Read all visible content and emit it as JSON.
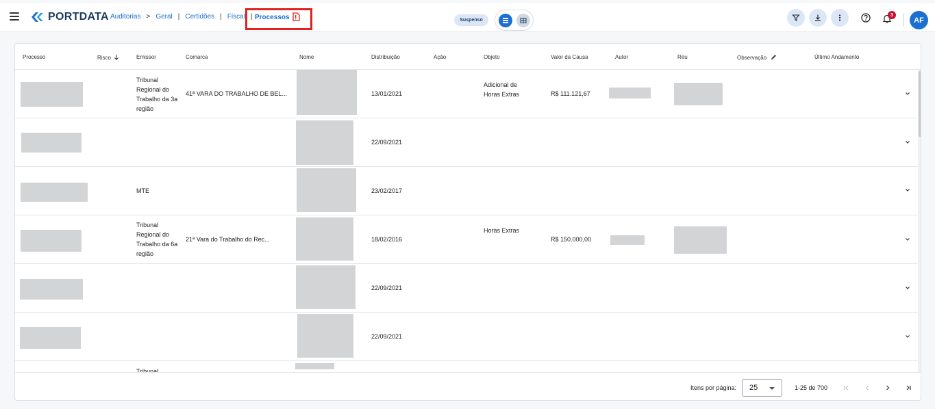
{
  "header": {
    "logo_text": "PORTDATA",
    "breadcrumb": [
      "Auditorias",
      "Geral",
      "Certidões",
      "Fiscal"
    ],
    "breadcrumb_arrow": ">",
    "breadcrumb_sep": "|",
    "current_page": "Processos",
    "status": "Suspenso",
    "notification_count": "3",
    "avatar_initials": "AF"
  },
  "table": {
    "columns": {
      "processo": "Processo",
      "risco": "Risco",
      "emissor": "Emissor",
      "comarca": "Comarca",
      "nome": "Nome",
      "distribuicao": "Distribuição",
      "acao": "Ação",
      "objeto": "Objeto",
      "valor": "Valor da Causa",
      "autor": "Autor",
      "reu": "Réu",
      "observacao": "Observação",
      "andamento": "Último Andamento"
    },
    "rows": [
      {
        "emissor": "Tribunal Regional do Trabalho da 3a região",
        "comarca": "41ª VARA DO TRABALHO DE BEL...",
        "distribuicao": "13/01/2021",
        "objeto": "Adicional de Horas Extras",
        "valor": "R$ 111.121,67"
      },
      {
        "emissor": "",
        "comarca": "",
        "distribuicao": "22/09/2021",
        "objeto": "",
        "valor": ""
      },
      {
        "emissor": "MTE",
        "comarca": "",
        "distribuicao": "23/02/2017",
        "objeto": "",
        "valor": ""
      },
      {
        "emissor": "Tribunal Regional do Trabalho da 6a região",
        "comarca": "21ª Vara do Trabalho do Rec...",
        "distribuicao": "18/02/2016",
        "objeto": "Horas Extras",
        "valor": "R$ 150.000,00"
      },
      {
        "emissor": "",
        "comarca": "",
        "distribuicao": "22/09/2021",
        "objeto": "",
        "valor": ""
      },
      {
        "emissor": "",
        "comarca": "",
        "distribuicao": "22/09/2021",
        "objeto": "",
        "valor": ""
      },
      {
        "emissor": "Tribunal",
        "comarca": "",
        "distribuicao": "",
        "objeto": "",
        "valor": ""
      }
    ]
  },
  "pagination": {
    "items_per_page_label": "Itens por página:",
    "items_per_page": "25",
    "range": "1-25 de 700"
  },
  "colors": {
    "accent": "#1b6fd1",
    "highlight_box": "#e32020",
    "badge": "#c8102e"
  }
}
